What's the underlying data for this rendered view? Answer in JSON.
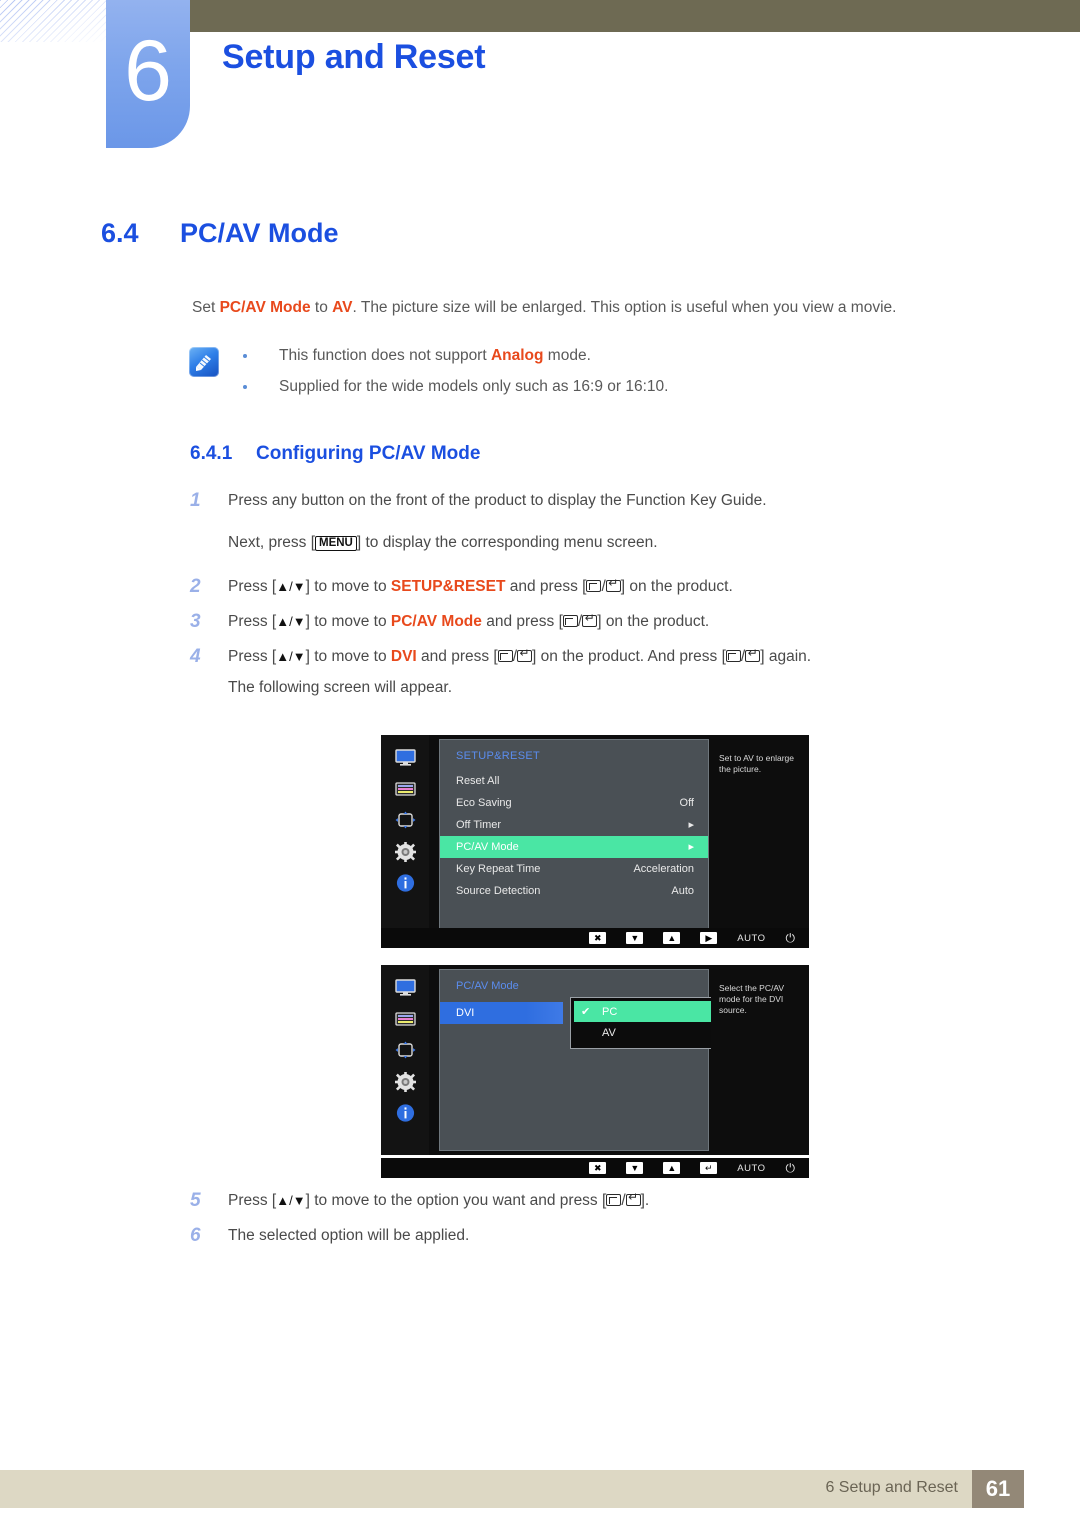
{
  "header": {
    "chapter_number": "6",
    "chapter_title": "Setup and Reset"
  },
  "section": {
    "number": "6.4",
    "title": "PC/AV Mode"
  },
  "intro": {
    "part1": "Set ",
    "bold1": "PC/AV Mode",
    "part2": " to ",
    "bold2": "AV",
    "part3": ". The picture size will be enlarged. This option is useful when you view a movie."
  },
  "notes": [
    {
      "pre": "This function does not support ",
      "bold": "Analog",
      "post": " mode."
    },
    {
      "pre": "Supplied for the wide models only such as 16:9 or 16:10.",
      "bold": "",
      "post": ""
    }
  ],
  "subsection": {
    "number": "6.4.1",
    "title": "Configuring PC/AV Mode"
  },
  "steps": {
    "s1_num": "1",
    "s1_text": "Press any button on the front of the product to display the Function Key Guide.",
    "s1_sub_pre": "Next, press [",
    "s1_sub_key": "MENU",
    "s1_sub_post": "] to display the corresponding menu screen.",
    "s2_num": "2",
    "s2_a": "Press [",
    "s2_arrows": "▲/▼",
    "s2_b": "] to move to ",
    "s2_bold": "SETUP&RESET",
    "s2_c": " and press [",
    "s2_d": "] on the product.",
    "s3_num": "3",
    "s3_bold": "PC/AV Mode",
    "s4_num": "4",
    "s4_bold": "DVI",
    "s4_d": "] on the product. And press [",
    "s4_e": "] again.",
    "s4_follow": "The following screen will appear.",
    "s5_num": "5",
    "s5_a": "Press [",
    "s5_b": "] to move to the option you want and press [",
    "s5_c": "].",
    "s6_num": "6",
    "s6_text": "The selected option will be applied."
  },
  "osd1": {
    "menu_title": "SETUP&RESET",
    "rows": [
      {
        "label": "Reset All",
        "value": ""
      },
      {
        "label": "Eco Saving",
        "value": "Off"
      },
      {
        "label": "Off Timer",
        "value": "▸"
      },
      {
        "label": "PC/AV Mode",
        "value": "▸",
        "selected": true
      },
      {
        "label": "Key Repeat Time",
        "value": "Acceleration"
      },
      {
        "label": "Source Detection",
        "value": "Auto"
      }
    ],
    "help": "Set to AV to enlarge the picture.",
    "bar": {
      "close": "✖",
      "down": "▼",
      "up": "▲",
      "right": "▶",
      "auto": "AUTO",
      "power": "⏻"
    },
    "sidebar_icons": [
      "display-icon",
      "color-bars-icon",
      "size-position-icon",
      "gear-icon",
      "info-icon"
    ]
  },
  "osd2": {
    "menu_title": "PC/AV Mode",
    "source_label": "DVI",
    "options": [
      {
        "label": "PC",
        "checked": true
      },
      {
        "label": "AV",
        "checked": false
      }
    ],
    "check_mark": "✔",
    "help": "Select the PC/AV mode for the DVI source.",
    "bar": {
      "close": "✖",
      "down": "▼",
      "up": "▲",
      "enter": "↵",
      "auto": "AUTO",
      "power": "⏻"
    }
  },
  "footer": {
    "text": "6 Setup and Reset",
    "page": "61"
  },
  "colors": {
    "brand_blue": "#1b4fe0",
    "accent_orange": "#e8491c",
    "osd_green": "#4ae6a4",
    "osd_blue": "#2f6ee0",
    "olive": "#6e6a53",
    "footer_tan": "#ddd8c4"
  }
}
